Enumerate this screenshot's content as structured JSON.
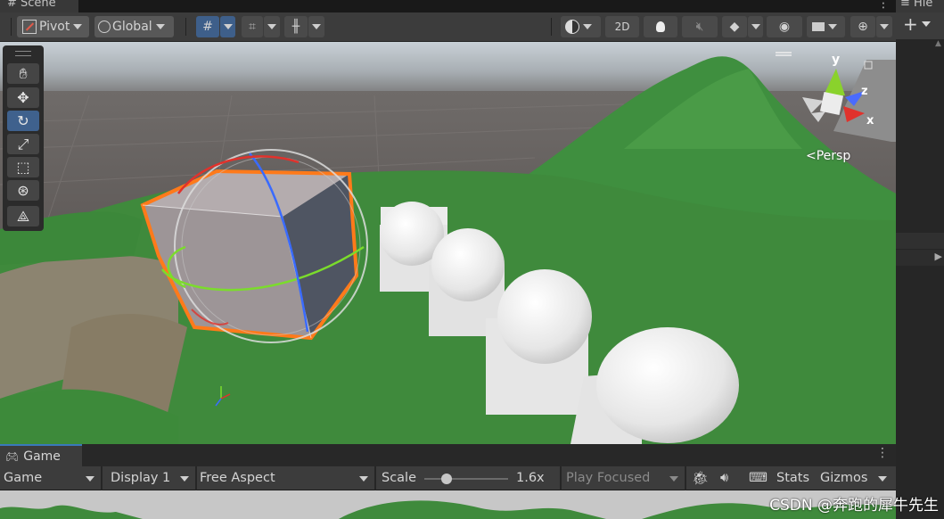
{
  "scene_tab": {
    "label": "# Scene"
  },
  "scene_toolbar": {
    "pivot_label": "Pivot",
    "global_label": "Global",
    "mode_2d_label": "2D"
  },
  "viewport": {
    "persp_label": "Persp",
    "axis_x": "x",
    "axis_y": "y",
    "axis_z": "z"
  },
  "hierarchy": {
    "tab_label": "Hie"
  },
  "game": {
    "tab_label": "Game",
    "display_mode": "Game",
    "display": "Display 1",
    "aspect": "Free Aspect",
    "scale_label": "Scale",
    "scale_value": "1.6x",
    "scale_fraction": 0.27,
    "play_mode": "Play Focused",
    "stats_label": "Stats",
    "gizmos_label": "Gizmos"
  },
  "watermark": "CSDN @奔跑的犀牛先生",
  "colors": {
    "accent": "#3e5f8a",
    "terrain": "#3f8f3f",
    "selection": "#ff7a1a",
    "tab_highlight": "#3a79bb"
  }
}
